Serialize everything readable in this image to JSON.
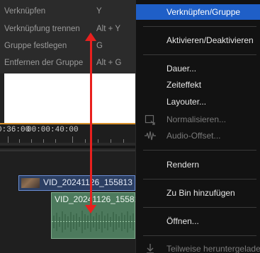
{
  "submenu": {
    "items": [
      {
        "label": "Verknüpfen",
        "shortcut": "Y"
      },
      {
        "label": "Verknüpfung trennen",
        "shortcut": "Alt + Y"
      },
      {
        "label": "Gruppe festlegen",
        "shortcut": "G"
      },
      {
        "label": "Entfernen der Gruppe",
        "shortcut": "Alt + G"
      }
    ]
  },
  "ruler": {
    "left_label": "0:36:00",
    "right_label": "00:00:40:00"
  },
  "clips": {
    "video_name": "VID_20241126_155813",
    "audio_name": "VID_20241126_155813"
  },
  "context_menu": {
    "items": [
      {
        "label": "Verknüpfen/Gruppe",
        "selected": true
      },
      {
        "label": "Aktivieren/Deaktivieren"
      },
      {
        "label": "Dauer..."
      },
      {
        "label": "Zeiteffekt"
      },
      {
        "label": "Layouter..."
      },
      {
        "label": "Normalisieren...",
        "disabled": true,
        "icon": "normalize-icon"
      },
      {
        "label": "Audio-Offset...",
        "disabled": true,
        "icon": "audio-offset-icon"
      },
      {
        "label": "Rendern"
      },
      {
        "label": "Zu Bin hinzufügen"
      },
      {
        "label": "Öffnen..."
      },
      {
        "label": "Teilweise heruntergeladen",
        "disabled": true,
        "icon": "download-icon"
      }
    ]
  },
  "colors": {
    "selection": "#1f5fc7",
    "annotation_arrow": "#e8201e",
    "audio_clip": "#4d7a5d",
    "video_clip_border": "#6b8fd6",
    "playhead_line": "#d7902a"
  }
}
